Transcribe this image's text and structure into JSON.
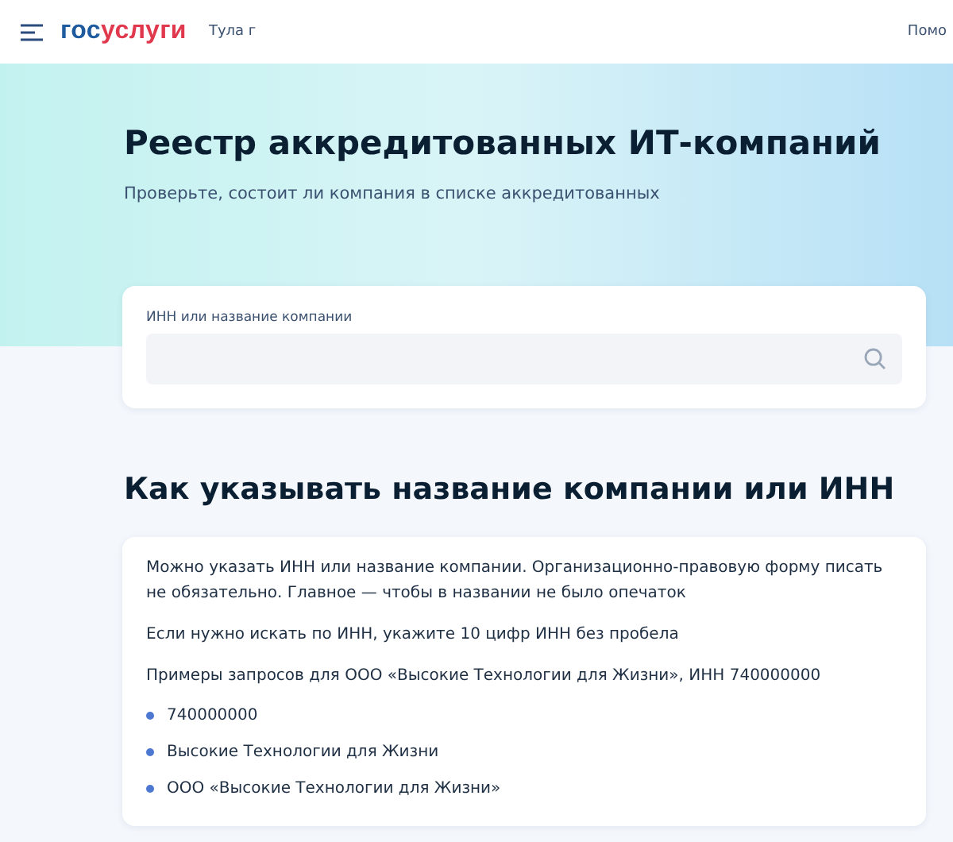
{
  "header": {
    "logo": {
      "first": "гос",
      "second": "услуги"
    },
    "city": "Тула г",
    "help": "Помо"
  },
  "hero": {
    "title": "Реестр аккредитованных ИТ-компаний",
    "subtitle": "Проверьте, состоит ли компания в списке аккредитованных"
  },
  "search": {
    "label": "ИНН или название компании"
  },
  "howto": {
    "title": "Как указывать название компании или ИНН",
    "paragraphs": [
      "Можно указать ИНН или название компании. Организационно-правовую форму писать не обязательно. Главное — чтобы в названии не было опечаток",
      "Если нужно искать по ИНН, укажите 10 цифр ИНН без пробела",
      "Примеры запросов для ООО «Высокие Технологии для Жизни», ИНН 740000000"
    ],
    "examples": [
      "740000000",
      "Высокие Технологии для Жизни",
      "ООО «Высокие Технологии для Жизни»"
    ]
  }
}
